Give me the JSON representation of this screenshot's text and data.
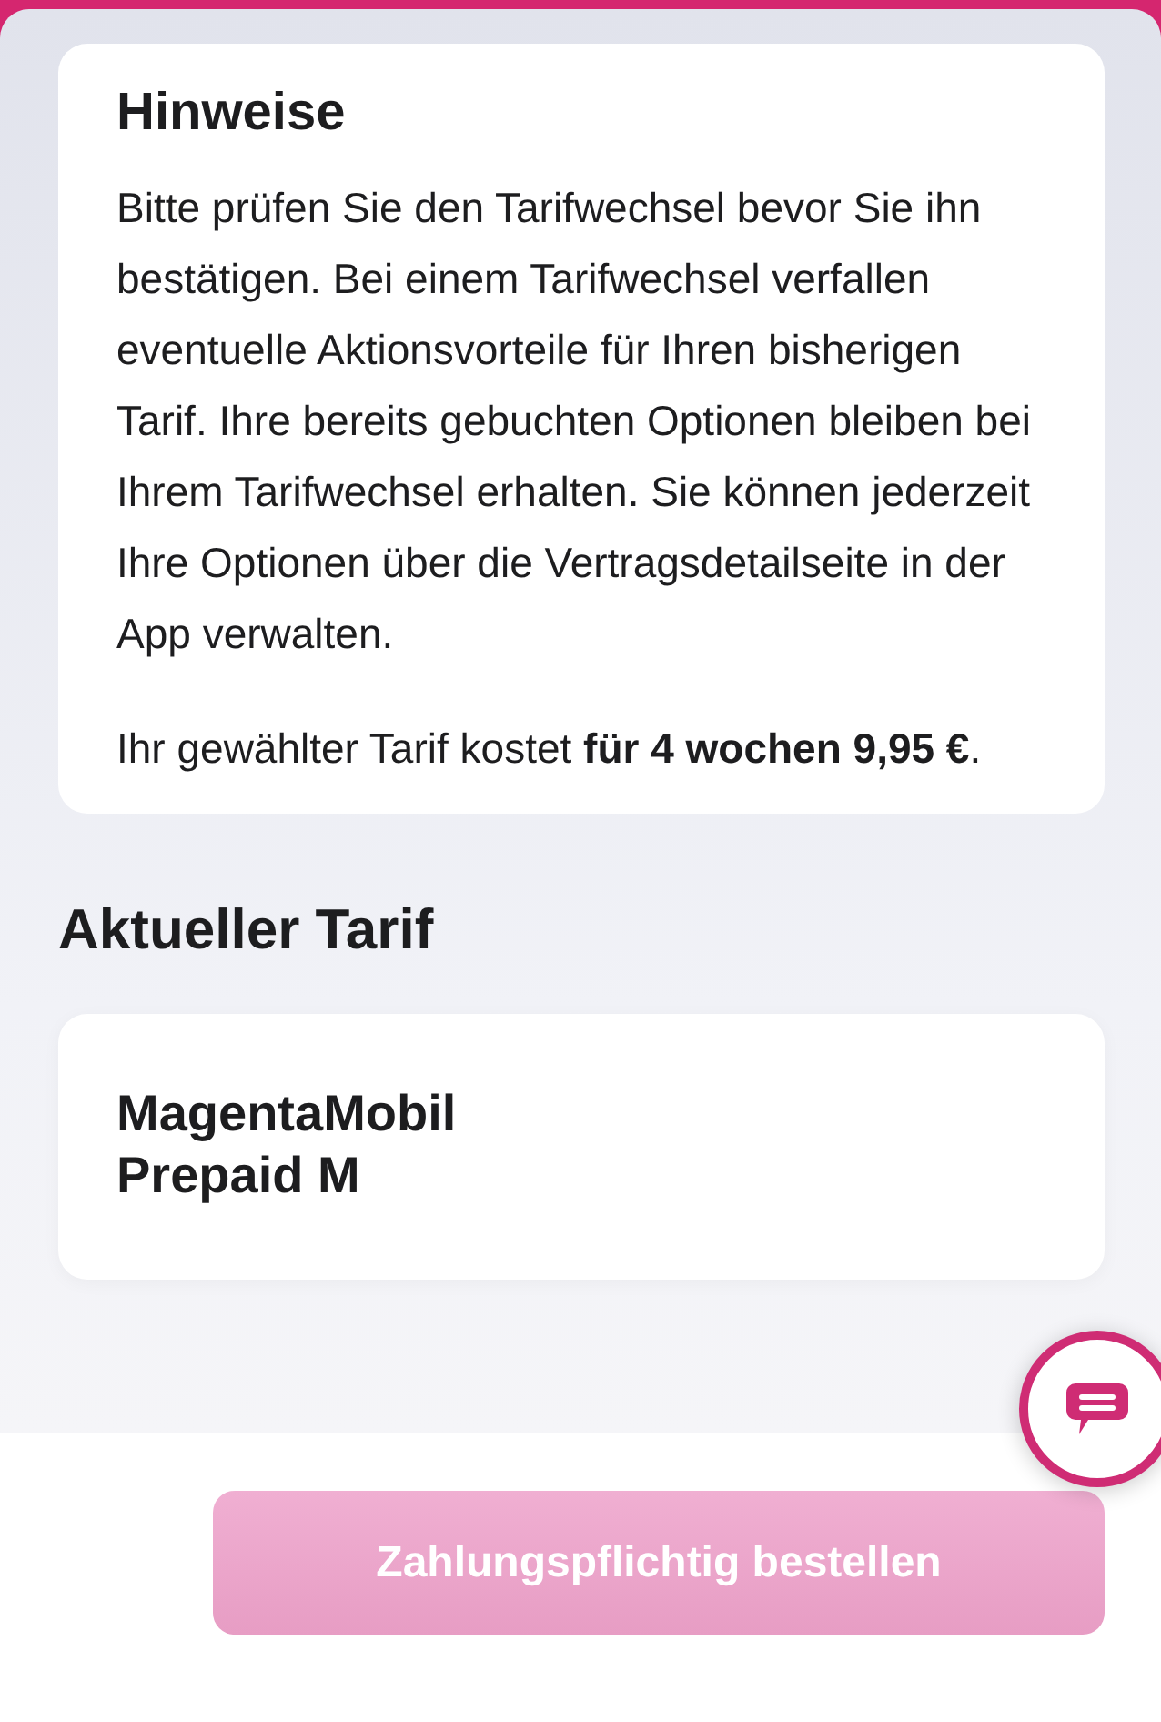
{
  "notes": {
    "title": "Hinweise",
    "text": "Bitte prüfen Sie den Tarifwechsel bevor Sie ihn bestätigen. Bei einem Tarifwechsel verfallen eventuelle Aktionsvorteile für Ihren bisherigen Tarif. Ihre bereits gebuchten Optionen bleiben bei Ihrem Tarifwechsel erhalten. Sie können jederzeit Ihre Optionen über die Vertragsdetailseite in der App verwalten.",
    "price_note": "Ihr gewählter Tarif kostet **für 4 wochen 9,95 €**."
  },
  "current_tariff": {
    "heading": "Aktueller Tarif",
    "name": "MagentaMobil Prepaid M"
  },
  "order_button": {
    "label": "Zahlungspflichtig bestellen",
    "disabled": true
  }
}
